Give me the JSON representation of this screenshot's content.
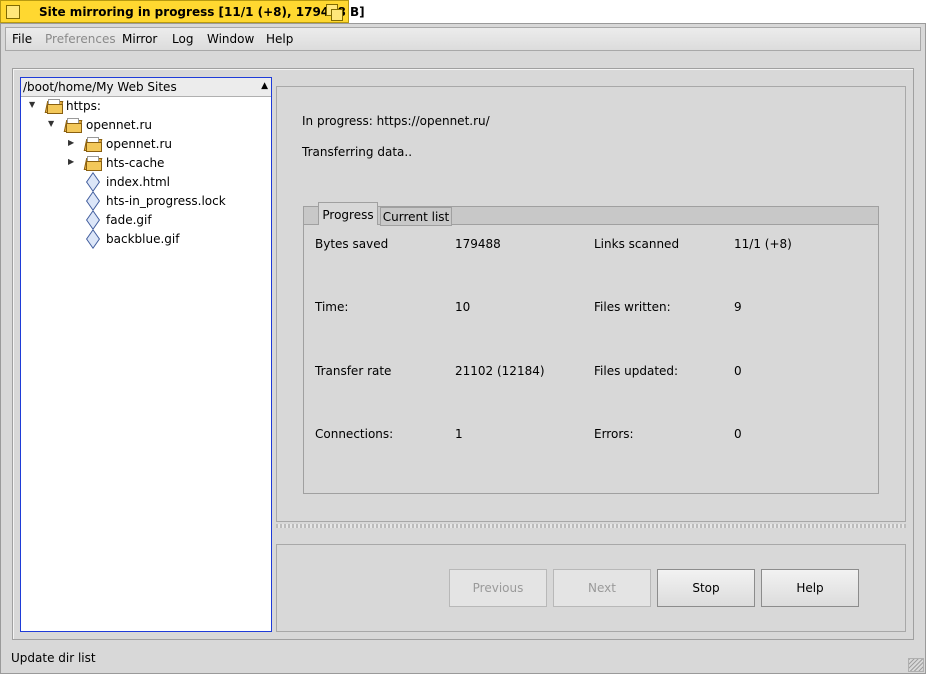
{
  "window": {
    "title": "Site mirroring in progress [11/1 (+8), 179488 B]"
  },
  "menubar": {
    "items": [
      {
        "label": "File",
        "enabled": true
      },
      {
        "label": "Preferences",
        "enabled": false
      },
      {
        "label": "Mirror",
        "enabled": true
      },
      {
        "label": "Log",
        "enabled": true
      },
      {
        "label": "Window",
        "enabled": true
      },
      {
        "label": "Help",
        "enabled": true
      }
    ]
  },
  "tree": {
    "path": "/boot/home/My Web Sites",
    "items": [
      {
        "label": "https:",
        "type": "folder",
        "expanded": true,
        "level": 0
      },
      {
        "label": "opennet.ru",
        "type": "folder",
        "expanded": true,
        "level": 1
      },
      {
        "label": "opennet.ru",
        "type": "folder",
        "expanded": false,
        "level": 2
      },
      {
        "label": "hts-cache",
        "type": "folder",
        "expanded": false,
        "level": 2
      },
      {
        "label": "index.html",
        "type": "file",
        "level": 2
      },
      {
        "label": "hts-in_progress.lock",
        "type": "file",
        "level": 2
      },
      {
        "label": "fade.gif",
        "type": "file",
        "level": 2
      },
      {
        "label": "backblue.gif",
        "type": "file",
        "level": 2
      }
    ]
  },
  "status": {
    "in_progress": "In progress: https://opennet.ru/",
    "transferring": "Transferring data.."
  },
  "tabs": {
    "progress": "Progress",
    "current_list": "Current list",
    "active": "Progress"
  },
  "stats": {
    "bytes_saved_label": "Bytes saved",
    "bytes_saved": "179488",
    "links_scanned_label": "Links scanned",
    "links_scanned": "11/1 (+8)",
    "time_label": "Time:",
    "time": "10",
    "files_written_label": "Files written:",
    "files_written": "9",
    "transfer_rate_label": "Transfer rate",
    "transfer_rate": "21102 (12184)",
    "files_updated_label": "Files updated:",
    "files_updated": "0",
    "connections_label": "Connections:",
    "connections": "1",
    "errors_label": "Errors:",
    "errors": "0"
  },
  "buttons": {
    "previous": "Previous",
    "next": "Next",
    "stop": "Stop",
    "help": "Help"
  },
  "statusbar": {
    "text": "Update dir list"
  },
  "colors": {
    "title_tab": "#ffd830",
    "tree_focus_border": "#1e3bd8",
    "panel_bg": "#d8d8d8"
  }
}
